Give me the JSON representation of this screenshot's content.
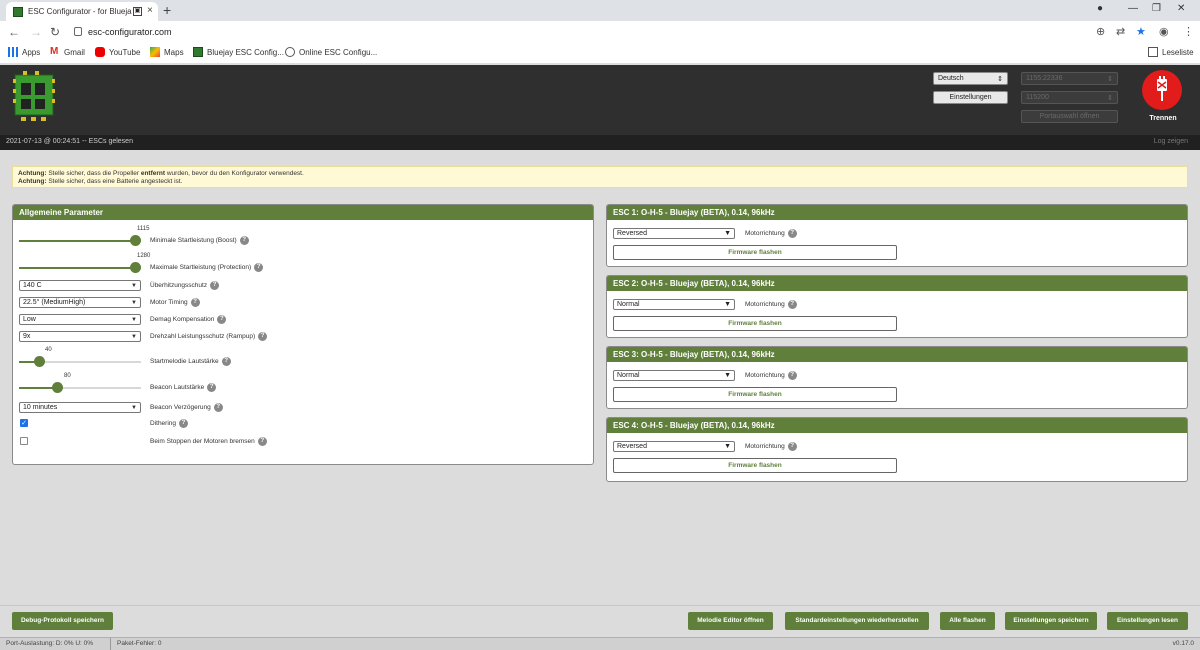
{
  "browser": {
    "tab_title": "ESC Configurator - for Blueja",
    "url": "esc-configurator.com",
    "bookmarks": [
      {
        "label": "Apps",
        "icon": "apps-grid-icon"
      },
      {
        "label": "Gmail",
        "icon": "gmail-icon"
      },
      {
        "label": "YouTube",
        "icon": "youtube-icon"
      },
      {
        "label": "Maps",
        "icon": "maps-icon"
      },
      {
        "label": "Bluejay ESC Config...",
        "icon": "esc-favicon"
      },
      {
        "label": "Online ESC Configu...",
        "icon": "globe-icon"
      }
    ],
    "reading_list": "Leseliste"
  },
  "header": {
    "language": "Deutsch",
    "settings_button": "Einstellungen",
    "port": "1155:22336",
    "baud": "115200",
    "port_select_button": "Portauswahl öffnen",
    "connect_label": "Trennen",
    "status": "2021-07-13 @ 00:24:51 -- ESCs gelesen",
    "log_toggle": "Log zeigen"
  },
  "warnings": [
    {
      "prefix": "Achtung:",
      "text_a": "Stelle sicher, dass die Propeller ",
      "bold": "entfernt",
      "text_b": " wurden, bevor du den Konfigurator verwendest."
    },
    {
      "prefix": "Achtung:",
      "text_a": "Stelle sicher, dass eine Batterie angesteckt ist."
    }
  ],
  "common": {
    "title": "Allgemeine Parameter",
    "min_startup": {
      "value": "1115",
      "label": "Minimale Startleistung (Boost)",
      "fraction": 1.0
    },
    "max_startup": {
      "value": "1280",
      "label": "Maximale Startleistung (Protection)",
      "fraction": 1.0
    },
    "temp_protection": {
      "value": "140 C",
      "label": "Überhitzungsschutz"
    },
    "motor_timing": {
      "value": "22.5° (MediumHigh)",
      "label": "Motor Timing"
    },
    "demag": {
      "value": "Low",
      "label": "Demag Kompensation"
    },
    "rampup": {
      "value": "9x",
      "label": "Drehzahl Leistungsschutz (Rampup)"
    },
    "startup_volume": {
      "value": "40",
      "label": "Startmelodie Lautstärke",
      "fraction": 0.16
    },
    "beacon_volume": {
      "value": "80",
      "label": "Beacon Lautstärke",
      "fraction": 0.31
    },
    "beacon_delay": {
      "value": "10 minutes",
      "label": "Beacon Verzögerung"
    },
    "dithering": {
      "label": "Dithering",
      "checked": true
    },
    "brake_on_stop": {
      "label": "Beim Stoppen der Motoren bremsen",
      "checked": false
    }
  },
  "escs": [
    {
      "title": "ESC 1: O-H-5 - Bluejay (BETA), 0.14, 96kHz",
      "direction": "Reversed",
      "direction_label": "Motorrichtung",
      "flash": "Firmware flashen"
    },
    {
      "title": "ESC 2: O-H-5 - Bluejay (BETA), 0.14, 96kHz",
      "direction": "Normal",
      "direction_label": "Motorrichtung",
      "flash": "Firmware flashen"
    },
    {
      "title": "ESC 3: O-H-5 - Bluejay (BETA), 0.14, 96kHz",
      "direction": "Normal",
      "direction_label": "Motorrichtung",
      "flash": "Firmware flashen"
    },
    {
      "title": "ESC 4: O-H-5 - Bluejay (BETA), 0.14, 96kHz",
      "direction": "Reversed",
      "direction_label": "Motorrichtung",
      "flash": "Firmware flashen"
    }
  ],
  "footer": {
    "debug_save": "Debug-Protokoll speichern",
    "melody_editor": "Melodie Editor öffnen",
    "restore_defaults": "Standardeinstellungen wiederherstellen",
    "flash_all": "Alle flashen",
    "save_settings": "Einstellungen speichern",
    "read_settings": "Einstellungen lesen"
  },
  "bottom": {
    "port_usage": "Port-Auslastung: D: 0% U: 0%",
    "packet_errors": "Paket-Fehler: 0",
    "version": "v0.17.0"
  },
  "colors": {
    "accent": "#5f7f3b",
    "connect": "#e21b1b"
  }
}
